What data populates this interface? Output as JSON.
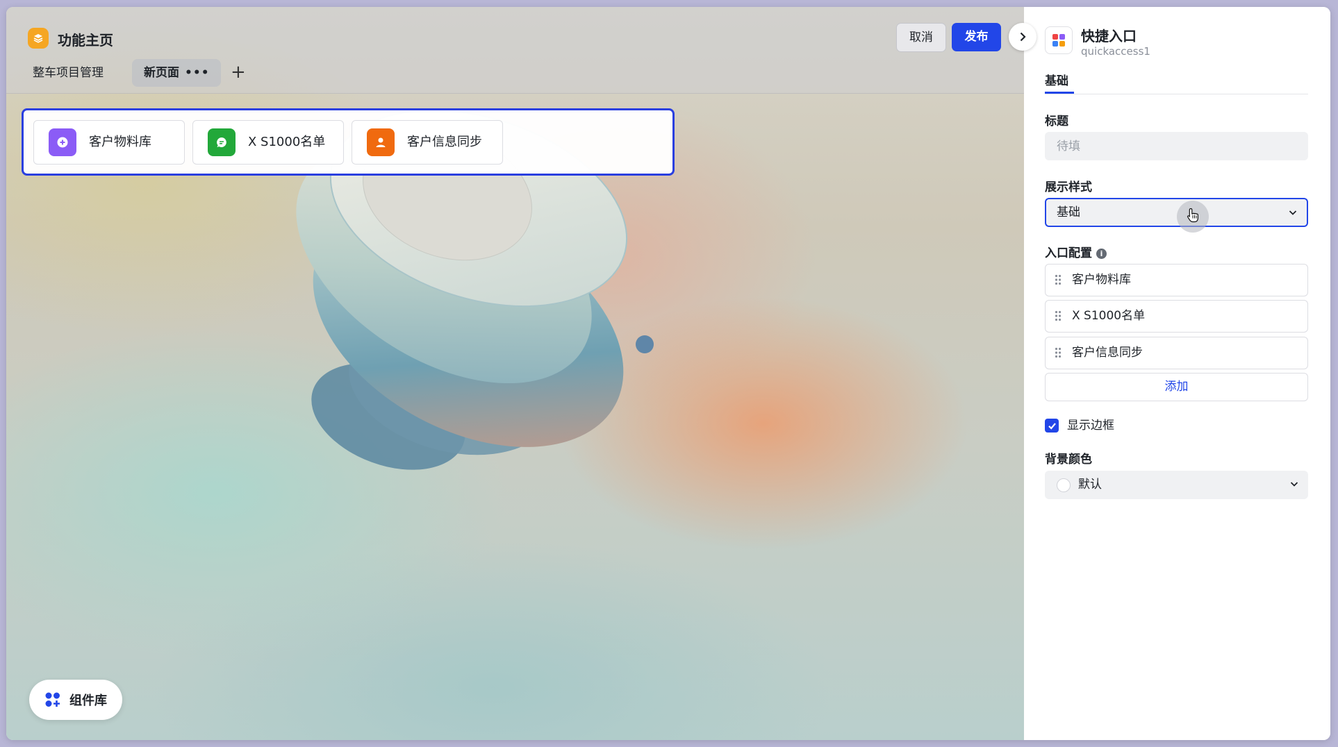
{
  "app": {
    "title": "功能主页",
    "tabs": [
      {
        "label": "整车项目管理"
      },
      {
        "label": "新页面",
        "more": "•••"
      }
    ],
    "add_tab": "+",
    "actions": {
      "cancel": "取消",
      "publish": "发布"
    }
  },
  "widget": {
    "items": [
      {
        "label": "客户物料库",
        "color": "#8b5cf6",
        "icon": "plus-circle-icon"
      },
      {
        "label": "X S1000名单",
        "color": "#22a83a",
        "icon": "chat-icon"
      },
      {
        "label": "客户信息同步",
        "color": "#f06a0f",
        "icon": "person-icon"
      }
    ]
  },
  "component_library": {
    "label": "组件库"
  },
  "panel": {
    "component_title": "快捷入口",
    "component_id": "quickaccess1",
    "tab": "基础",
    "title_field": {
      "label": "标题",
      "placeholder": "待填",
      "value": ""
    },
    "style_field": {
      "label": "展示样式",
      "value": "基础"
    },
    "entries": {
      "label": "入口配置",
      "info": "i",
      "items": [
        "客户物料库",
        "X S1000名单",
        "客户信息同步"
      ],
      "add_label": "添加"
    },
    "show_border": {
      "label": "显示边框",
      "checked": true
    },
    "bg_color": {
      "label": "背景颜色",
      "value": "默认"
    }
  },
  "colors": {
    "accent": "#2246e8",
    "logo": "#f5a623"
  }
}
